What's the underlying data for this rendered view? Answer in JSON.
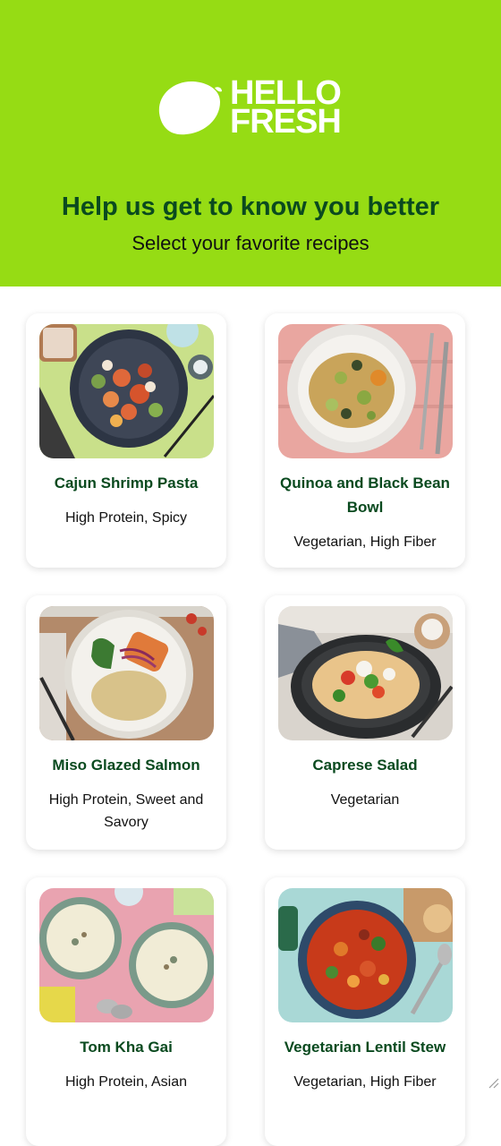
{
  "brand": {
    "line1": "HELLO",
    "line2": "FRESH",
    "accent": "#96dc14",
    "title_color": "#0a4a1f"
  },
  "header": {
    "headline": "Help us get to know you better",
    "subheadline": "Select your favorite recipes"
  },
  "recipes": [
    {
      "title": "Cajun Shrimp Pasta",
      "tags": "High Protein, Spicy"
    },
    {
      "title": "Quinoa and Black Bean Bowl",
      "tags": "Vegetarian, High Fiber"
    },
    {
      "title": "Miso Glazed Salmon",
      "tags": "High Protein, Sweet and Savory"
    },
    {
      "title": "Caprese Salad",
      "tags": "Vegetarian"
    },
    {
      "title": "Tom Kha Gai",
      "tags": "High Protein, Asian"
    },
    {
      "title": "Vegetarian Lentil Stew",
      "tags": "Vegetarian, High Fiber"
    }
  ]
}
